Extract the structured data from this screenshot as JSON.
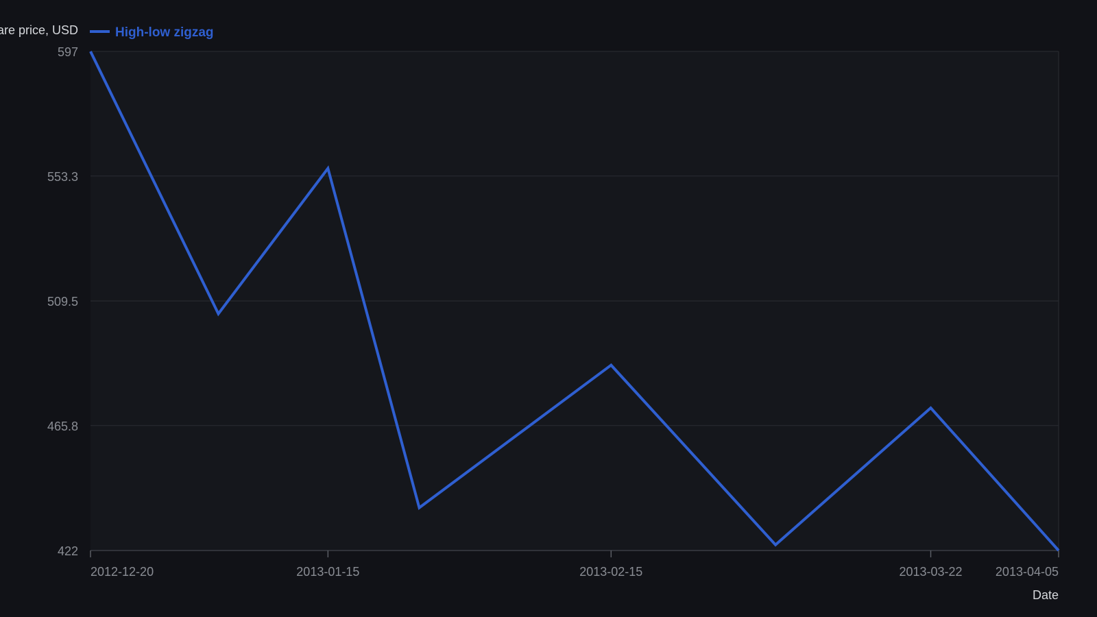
{
  "chart_data": {
    "type": "line",
    "ylabel": "Share price, USD",
    "xlabel": "Date",
    "x_ticks": [
      "2012-12-20",
      "2013-01-15",
      "2013-02-15",
      "2013-03-22",
      "2013-04-05"
    ],
    "y_ticks": [
      "597",
      "553.3",
      "509.5",
      "465.8",
      "422"
    ],
    "ylim": [
      422,
      597
    ],
    "xlim": [
      "2012-12-20",
      "2013-04-05"
    ],
    "grid": true,
    "legend_position": "top-left",
    "series": [
      {
        "name": "High-low zigzag",
        "color": "#2f5fd0",
        "points": [
          {
            "x": "2012-12-20",
            "y": 597
          },
          {
            "x": "2013-01-03",
            "y": 505
          },
          {
            "x": "2013-01-15",
            "y": 556
          },
          {
            "x": "2013-01-25",
            "y": 437
          },
          {
            "x": "2013-02-15",
            "y": 487
          },
          {
            "x": "2013-03-05",
            "y": 424
          },
          {
            "x": "2013-03-22",
            "y": 472
          },
          {
            "x": "2013-04-05",
            "y": 422
          }
        ]
      }
    ]
  }
}
